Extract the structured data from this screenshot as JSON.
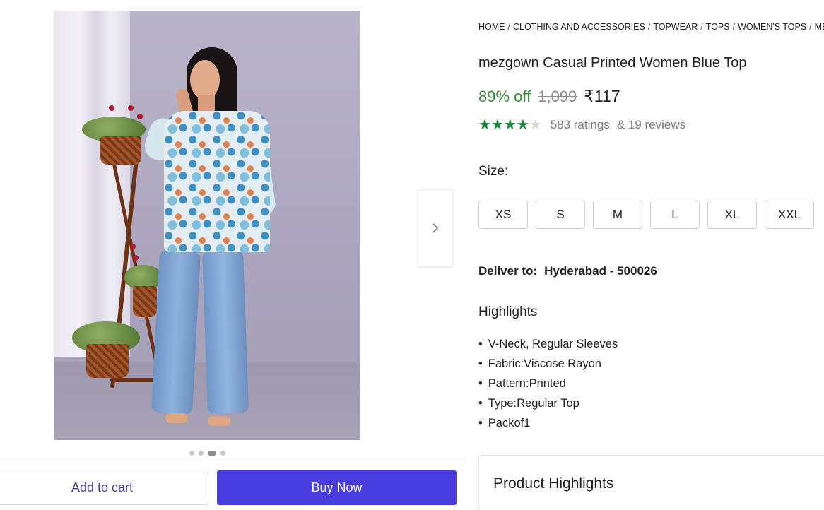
{
  "breadcrumb": [
    "HOME",
    "CLOTHING AND ACCESSORIES",
    "TOPWEAR",
    "TOPS",
    "WOMEN'S TOPS",
    "ME"
  ],
  "product": {
    "title": "mezgown Casual Printed Women Blue Top",
    "discount": "89% off",
    "mrp": "1,099",
    "price": "₹117",
    "rating_stars": 4,
    "ratings_text": "583 ratings",
    "reviews_text": "& 19 reviews"
  },
  "size": {
    "label": "Size:",
    "options": [
      "XS",
      "S",
      "M",
      "L",
      "XL",
      "XXL"
    ]
  },
  "delivery": {
    "label": "Deliver to:",
    "location": "Hyderabad - 500026"
  },
  "highlights": {
    "title": "Highlights",
    "items": [
      "V-Neck, Regular Sleeves",
      "Fabric:Viscose Rayon",
      "Pattern:Printed",
      "Type:Regular Top",
      "Packof1"
    ]
  },
  "product_highlights": {
    "title": "Product Highlights"
  },
  "gallery": {
    "dot_count": 4,
    "active_dot": 3
  },
  "actions": {
    "add_to_cart": "Add to cart",
    "buy_now": "Buy Now"
  },
  "colors": {
    "accent": "#4a3de0",
    "discount": "#388e3c",
    "star": "#14873a"
  },
  "icons": {
    "carousel_next": "chevron-right-icon"
  }
}
